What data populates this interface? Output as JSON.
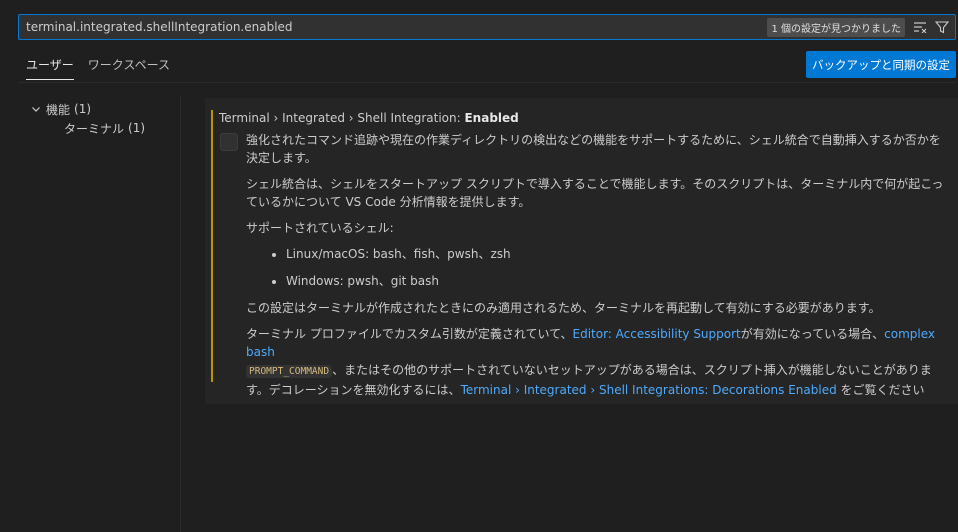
{
  "search": {
    "value": "terminal.integrated.shellIntegration.enabled",
    "results_badge": "1 個の設定が見つかりました",
    "clear_filter_icon": "clear-filter-icon",
    "filter_icon": "filter-icon"
  },
  "tabs": [
    {
      "label": "ユーザー",
      "active": true
    },
    {
      "label": "ワークスペース",
      "active": false
    }
  ],
  "backup_button": "バックアップと同期の設定",
  "toc": {
    "group_label": "機能",
    "group_count": "(1)",
    "items": [
      {
        "label": "ターミナル",
        "count": "(1)"
      }
    ]
  },
  "setting": {
    "category": "Terminal › Integrated › Shell Integration: ",
    "key": "Enabled",
    "desc_p1": "強化されたコマンド追跡や現在の作業ディレクトリの検出などの機能をサポートするために、シェル統合で自動挿入するか否かを決定します。",
    "desc_p2": "シェル統合は、シェルをスタートアップ スクリプトで導入することで機能します。そのスクリプトは、ターミナル内で何が起こっているかについて VS Code 分析情報を提供します。",
    "desc_supported": "サポートされているシェル:",
    "shells": [
      "Linux/macOS: bash、fish、pwsh、zsh",
      "Windows: pwsh、git bash"
    ],
    "desc_p4": "この設定はターミナルが作成されたときにのみ適用されるため、ターミナルを再起動して有効にする必要があります。",
    "p5_text1": "ターミナル プロファイルでカスタム引数が定義されていて、",
    "p5_link1": "Editor: Accessibility Support",
    "p5_text2": "が有効になっている場合、",
    "p5_link2": "complex bash",
    "p5_code": "PROMPT_COMMAND",
    "p5_text3": "、またはその他のサポートされていないセットアップがある場合は、スクリプト挿入が機能しないことがあります。デコレーションを無効化するには、",
    "p5_link3": "Terminal › Integrated › Shell Integrations: Decorations Enabled",
    "p5_text4": " をご覧ください"
  },
  "colors": {
    "accent": "#0078d4",
    "modified_indicator": "#b89500",
    "link": "#4daafc"
  }
}
